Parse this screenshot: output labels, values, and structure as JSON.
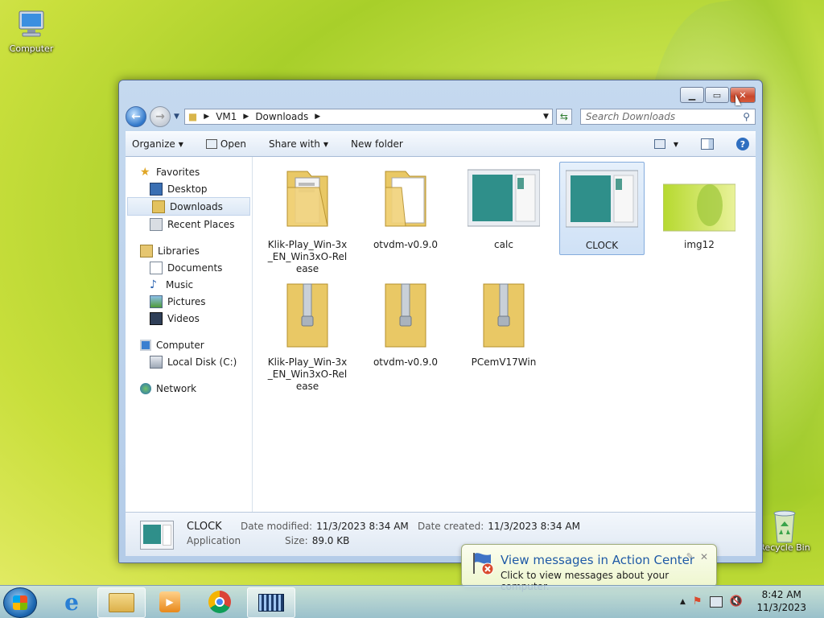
{
  "desktop": {
    "computer_label": "Computer",
    "recycle_label": "Recycle Bin"
  },
  "window": {
    "address": {
      "parts": [
        "VM1",
        "Downloads"
      ]
    },
    "search_placeholder": "Search Downloads",
    "toolbar": {
      "organize": "Organize",
      "open": "Open",
      "share_with": "Share with",
      "new_folder": "New folder"
    },
    "nav": {
      "favorites": "Favorites",
      "desktop": "Desktop",
      "downloads": "Downloads",
      "recent": "Recent Places",
      "libraries": "Libraries",
      "documents": "Documents",
      "music": "Music",
      "pictures": "Pictures",
      "videos": "Videos",
      "computer": "Computer",
      "local_disk": "Local Disk (C:)",
      "network": "Network"
    },
    "files": [
      {
        "name": "Klik-Play_Win-3x_EN_Win3xO-Release",
        "kind": "folder"
      },
      {
        "name": "otvdm-v0.9.0",
        "kind": "folder"
      },
      {
        "name": "calc",
        "kind": "app"
      },
      {
        "name": "CLOCK",
        "kind": "app"
      },
      {
        "name": "img12",
        "kind": "image"
      },
      {
        "name": "Klik-Play_Win-3x_EN_Win3xO-Release",
        "kind": "zip"
      },
      {
        "name": "otvdm-v0.9.0",
        "kind": "zip"
      },
      {
        "name": "PCemV17Win",
        "kind": "zip"
      }
    ],
    "details": {
      "name": "CLOCK",
      "type": "Application",
      "modified_label": "Date modified:",
      "modified_value": "11/3/2023 8:34 AM",
      "size_label": "Size:",
      "size_value": "89.0 KB",
      "created_label": "Date created:",
      "created_value": "11/3/2023 8:34 AM"
    }
  },
  "notification": {
    "title": "View messages in Action Center",
    "message": "Click to view messages about your computer."
  },
  "taskbar": {
    "time": "8:42 AM",
    "date": "11/3/2023"
  }
}
